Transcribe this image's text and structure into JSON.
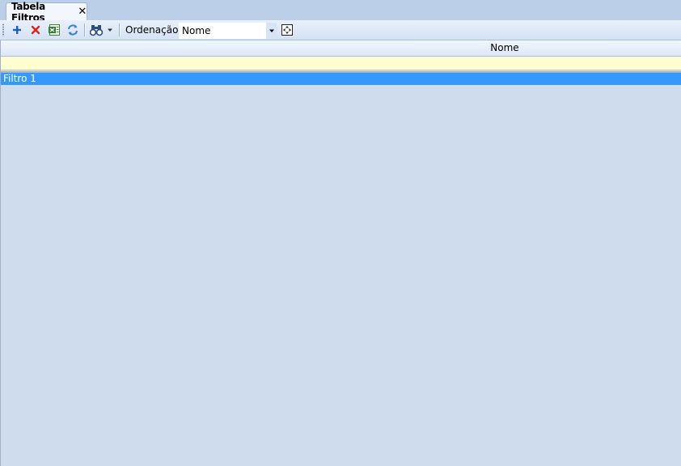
{
  "tab": {
    "title": "Tabela Filtros",
    "close_glyph": "✕"
  },
  "toolbar": {
    "buttons": [
      {
        "icon": "add-icon",
        "color": "#1a5fb4"
      },
      {
        "icon": "delete-icon",
        "color": "#e02020"
      },
      {
        "icon": "excel-export-icon",
        "color": "#2e7d32"
      },
      {
        "icon": "refresh-icon",
        "color": "#3d7fc9"
      },
      {
        "icon": "binoculars-icon",
        "color": "#2b4f7d"
      }
    ],
    "sort_label": "Ordenação:",
    "sort_value": "Nome"
  },
  "grid": {
    "columns": [
      "Nome"
    ],
    "rows": [
      {
        "nome": "Filtro 1",
        "selected": true
      }
    ]
  },
  "colors": {
    "selection": "#3399ff",
    "filter_row": "#ffffcf",
    "background": "#cfdcee"
  }
}
